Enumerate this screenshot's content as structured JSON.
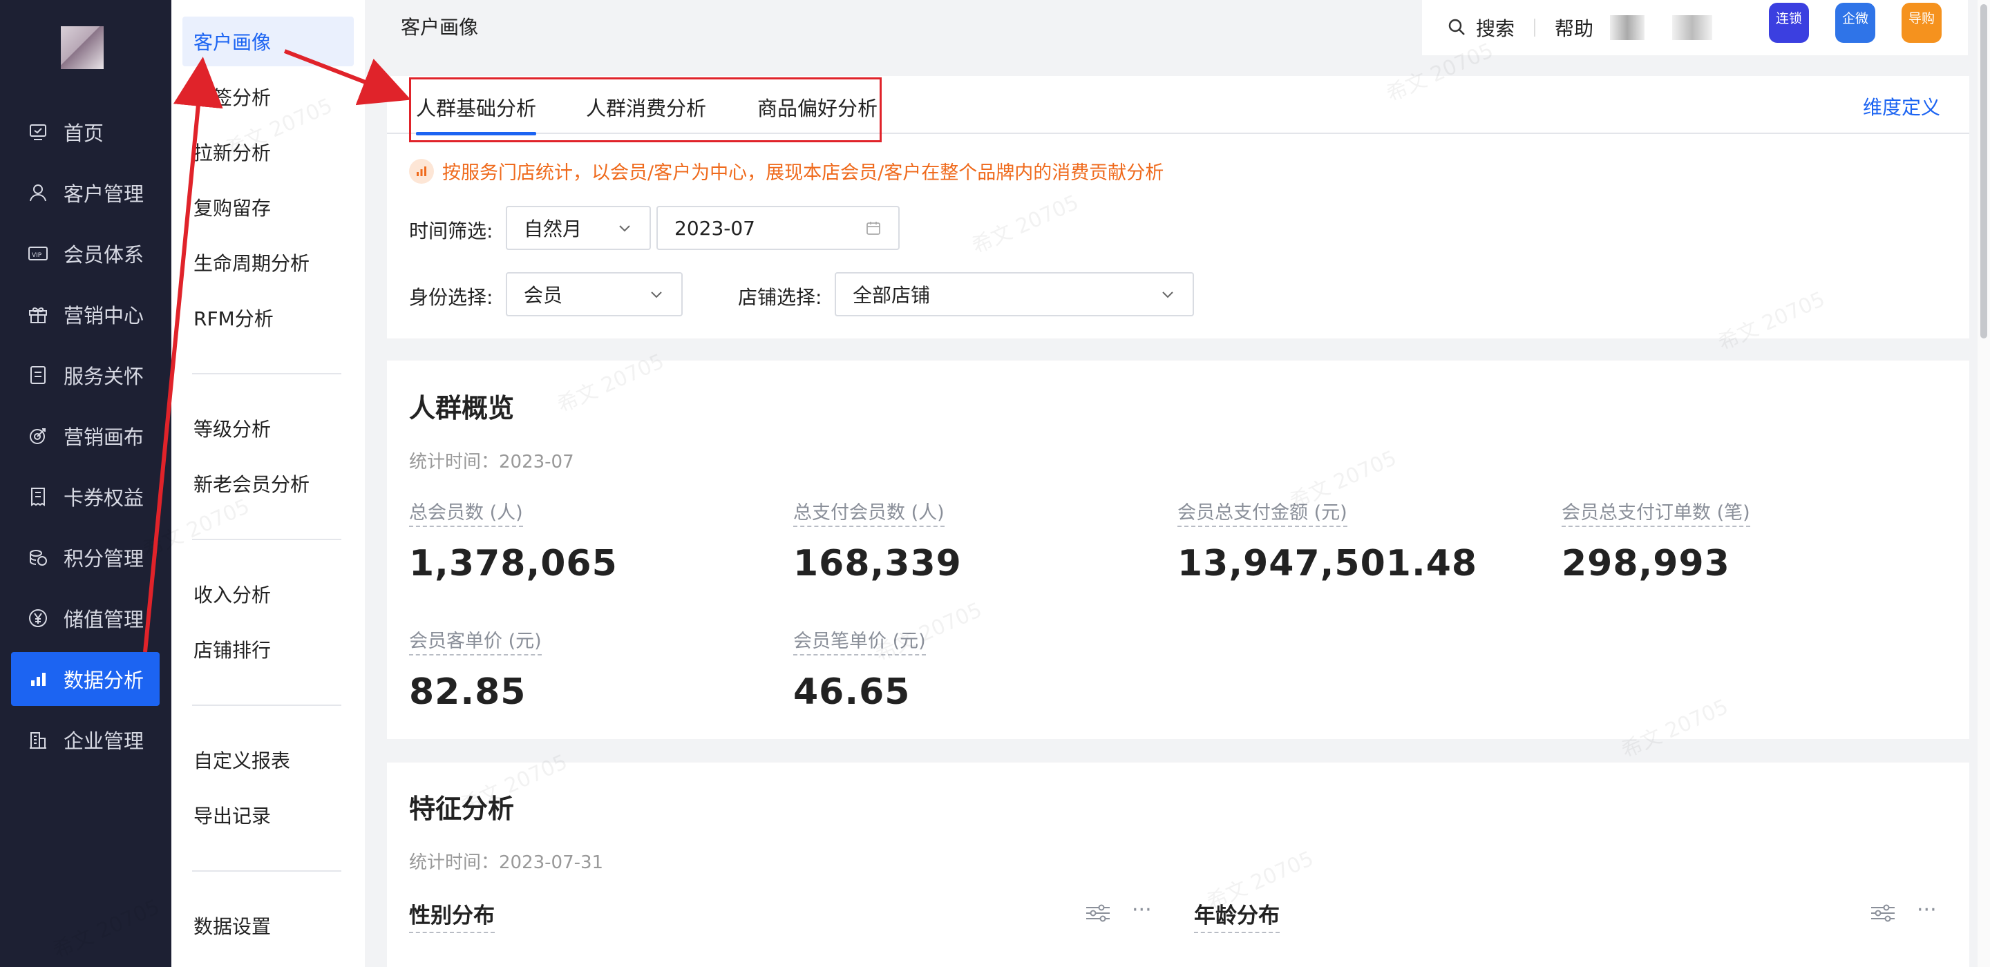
{
  "nav": {
    "items": [
      {
        "label": "首页",
        "icon": "home-icon"
      },
      {
        "label": "客户管理",
        "icon": "user-icon"
      },
      {
        "label": "会员体系",
        "icon": "vip-icon"
      },
      {
        "label": "营销中心",
        "icon": "gift-icon"
      },
      {
        "label": "服务关怀",
        "icon": "service-icon"
      },
      {
        "label": "营销画布",
        "icon": "target-icon"
      },
      {
        "label": "卡券权益",
        "icon": "coupon-icon"
      },
      {
        "label": "积分管理",
        "icon": "points-icon"
      },
      {
        "label": "储值管理",
        "icon": "yen-icon"
      },
      {
        "label": "数据分析",
        "icon": "bar-chart-icon",
        "active": true
      },
      {
        "label": "企业管理",
        "icon": "building-icon"
      }
    ]
  },
  "submenu": {
    "items": [
      "客户画像",
      "标签分析",
      "拉新分析",
      "复购留存",
      "生命周期分析",
      "RFM分析",
      "等级分析",
      "新老会员分析",
      "收入分析",
      "店铺排行",
      "自定义报表",
      "导出记录",
      "数据设置"
    ]
  },
  "topbar": {
    "page_title": "客户画像",
    "search_label": "搜索",
    "help_label": "帮助",
    "apps": [
      {
        "label": "连锁",
        "color": "#3b3fe0"
      },
      {
        "label": "企微",
        "color": "#2f74e8"
      },
      {
        "label": "导购",
        "color": "#f5921e"
      }
    ]
  },
  "tabs": [
    "人群基础分析",
    "人群消费分析",
    "商品偏好分析"
  ],
  "dimension_link": "维度定义",
  "hint": "按服务门店统计，以会员/客户为中心，展现本店会员/客户在整个品牌内的消费贡献分析",
  "filters": {
    "time_label": "时间筛选:",
    "time_mode": "自然月",
    "time_value": "2023-07",
    "identity_label": "身份选择:",
    "identity_value": "会员",
    "store_label": "店铺选择:",
    "store_value": "全部店铺"
  },
  "overview": {
    "title": "人群概览",
    "stat_time": "统计时间：2023-07",
    "metrics": [
      {
        "label": "总会员数 (人)",
        "value": "1,378,065"
      },
      {
        "label": "总支付会员数 (人)",
        "value": "168,339"
      },
      {
        "label": "会员总支付金额 (元)",
        "value": "13,947,501.48"
      },
      {
        "label": "会员总支付订单数 (笔)",
        "value": "298,993"
      },
      {
        "label": "会员客单价 (元)",
        "value": "82.85"
      },
      {
        "label": "会员笔单价 (元)",
        "value": "46.65"
      }
    ]
  },
  "features": {
    "title": "特征分析",
    "stat_time": "统计时间：2023-07-31",
    "gender_title": "性别分布",
    "age_title": "年龄分布"
  },
  "watermark": "希文 20705"
}
